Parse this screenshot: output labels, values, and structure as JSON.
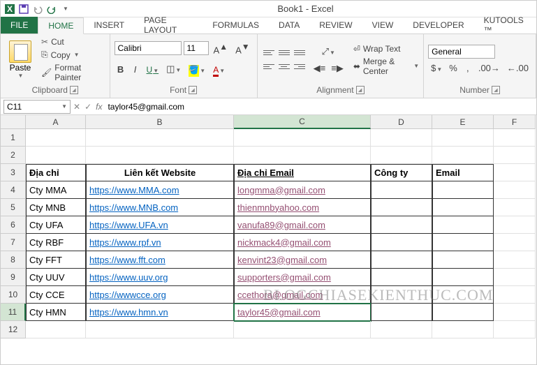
{
  "title": "Book1 - Excel",
  "tabs": {
    "file": "FILE",
    "home": "HOME",
    "insert": "INSERT",
    "page_layout": "PAGE LAYOUT",
    "formulas": "FORMULAS",
    "data": "DATA",
    "review": "REVIEW",
    "view": "VIEW",
    "developer": "DEVELOPER",
    "kutools": "KUTOOLS ™"
  },
  "ribbon": {
    "clipboard": {
      "label": "Clipboard",
      "paste": "Paste",
      "cut": "Cut",
      "copy": "Copy",
      "format_painter": "Format Painter"
    },
    "font": {
      "label": "Font",
      "name": "Calibri",
      "size": "11",
      "bold": "B",
      "italic": "I",
      "underline": "U"
    },
    "alignment": {
      "label": "Alignment",
      "wrap": "Wrap Text",
      "merge": "Merge & Center"
    },
    "number": {
      "label": "Number",
      "format": "General"
    }
  },
  "namebox": "C11",
  "formula": "taylor45@gmail.com",
  "cols": [
    "A",
    "B",
    "C",
    "D",
    "E",
    "F"
  ],
  "rows": [
    "1",
    "2",
    "3",
    "4",
    "5",
    "6",
    "7",
    "8",
    "9",
    "10",
    "11",
    "12"
  ],
  "headers": {
    "a": "Địa chỉ",
    "b": "Liên kết Website",
    "c": "Địa chỉ Email",
    "d": "Công ty",
    "e": "Email"
  },
  "data": [
    {
      "a": "Cty MMA",
      "b": "https://www.MMA.com",
      "c": "longmma@gmail.com"
    },
    {
      "a": "Cty MNB",
      "b": "https://www.MNB.com",
      "c": "thienmnbyahoo.com"
    },
    {
      "a": "Cty UFA",
      "b": "https://www.UFA.vn",
      "c": "vanufa89@gmail.com"
    },
    {
      "a": "Cty RBF",
      "b": "https://www.rpf.vn",
      "c": "nickmack4@gmail.com"
    },
    {
      "a": "Cty FFT",
      "b": "https://www.fft.com",
      "c": "kenvint23@gmail.com"
    },
    {
      "a": "Cty UUV",
      "b": "https://www.uuv.org",
      "c": "supporters@gmail.com"
    },
    {
      "a": "Cty CCE",
      "b": "https://wwwcce.org",
      "c": "ccethora@gmail.com"
    },
    {
      "a": "Cty HMN",
      "b": "https://www.hmn.vn",
      "c": "taylor45@gmail.com"
    }
  ],
  "watermark": "BLOGCHIASEKIENTHUC.COM"
}
